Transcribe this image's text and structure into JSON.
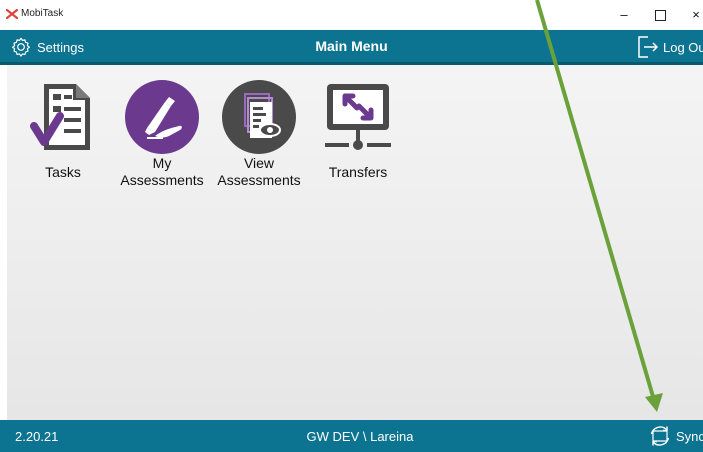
{
  "window": {
    "title": "MobiTask",
    "minimize_label": "–",
    "close_label": "×"
  },
  "topbar": {
    "settings_label": "Settings",
    "title": "Main Menu",
    "logout_label": "Log Ou"
  },
  "menu": {
    "items": [
      {
        "label": "Tasks",
        "icon": "task-checklist-icon"
      },
      {
        "label": "My\nAssessments",
        "icon": "pen-hand-icon"
      },
      {
        "label": "View\nAssessments",
        "icon": "document-eye-icon"
      },
      {
        "label": "Transfers",
        "icon": "monitor-transfer-icon"
      }
    ]
  },
  "statusbar": {
    "version": "2.20.21",
    "user": "GW DEV \\ Lareina",
    "sync_label": "Sync"
  },
  "colors": {
    "bar": "#0c7490",
    "purple": "#6b3a8f",
    "icon_dark": "#4a4a4a",
    "arrow": "#6aa13a"
  }
}
